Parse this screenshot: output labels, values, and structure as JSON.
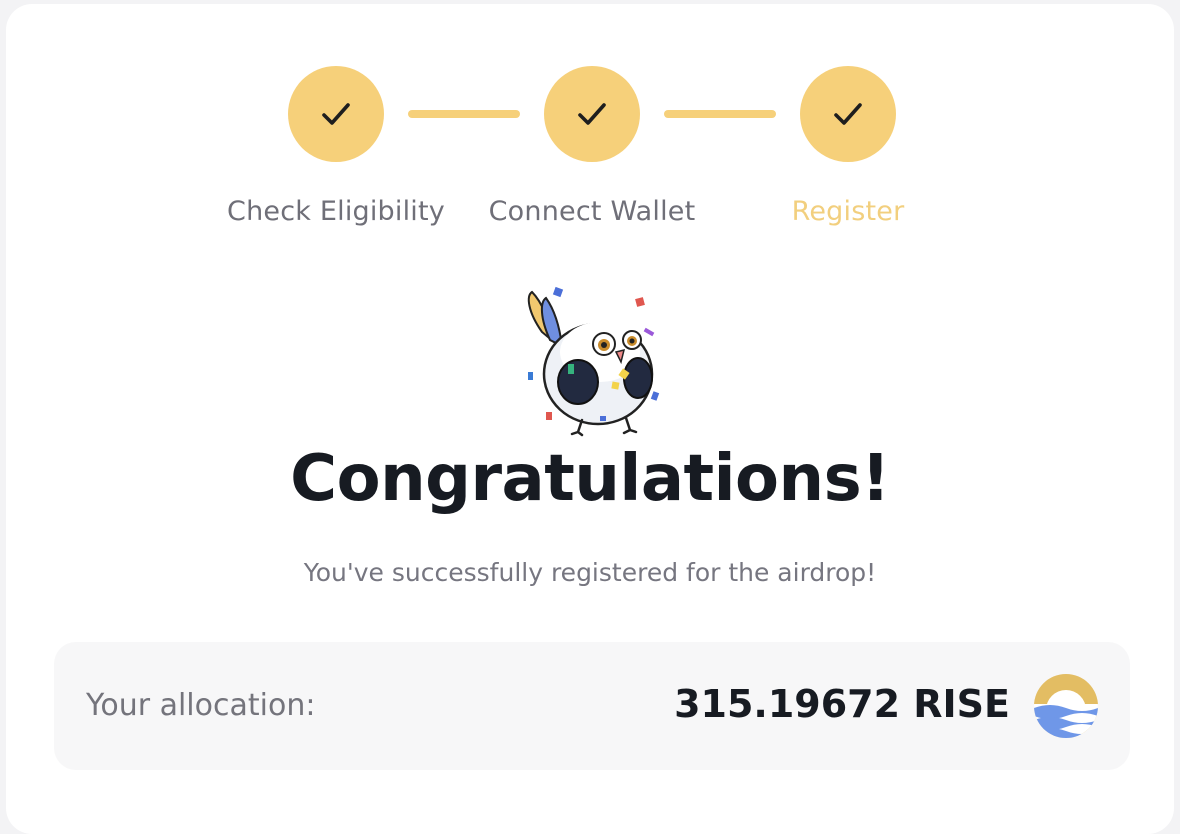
{
  "stepper": {
    "steps": [
      {
        "label": "Check Eligibility",
        "status": "complete"
      },
      {
        "label": "Connect Wallet",
        "status": "complete"
      },
      {
        "label": "Register",
        "status": "complete-active"
      }
    ],
    "accent_color": "#f6d07a",
    "active_label_color": "#f2cf7e",
    "icons": [
      "check-icon",
      "check-icon",
      "check-icon"
    ]
  },
  "mascot": {
    "icon": "celebrating-bird-illustration"
  },
  "headline": "Congratulations!",
  "subline": "You've successfully registered for the airdrop!",
  "allocation": {
    "label": "Your allocation:",
    "amount": "315.19672 RISE",
    "token_icon": "rise-token-icon"
  }
}
